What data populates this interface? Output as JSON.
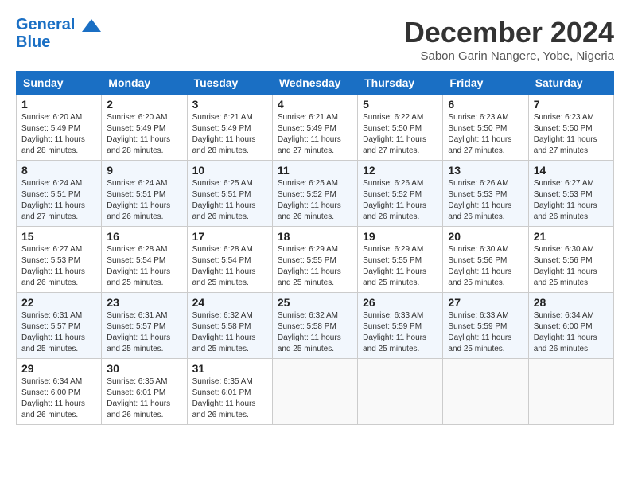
{
  "logo": {
    "line1": "General",
    "line2": "Blue"
  },
  "title": "December 2024",
  "location": "Sabon Garin Nangere, Yobe, Nigeria",
  "headers": [
    "Sunday",
    "Monday",
    "Tuesday",
    "Wednesday",
    "Thursday",
    "Friday",
    "Saturday"
  ],
  "weeks": [
    [
      {
        "day": "1",
        "info": "Sunrise: 6:20 AM\nSunset: 5:49 PM\nDaylight: 11 hours\nand 28 minutes."
      },
      {
        "day": "2",
        "info": "Sunrise: 6:20 AM\nSunset: 5:49 PM\nDaylight: 11 hours\nand 28 minutes."
      },
      {
        "day": "3",
        "info": "Sunrise: 6:21 AM\nSunset: 5:49 PM\nDaylight: 11 hours\nand 28 minutes."
      },
      {
        "day": "4",
        "info": "Sunrise: 6:21 AM\nSunset: 5:49 PM\nDaylight: 11 hours\nand 27 minutes."
      },
      {
        "day": "5",
        "info": "Sunrise: 6:22 AM\nSunset: 5:50 PM\nDaylight: 11 hours\nand 27 minutes."
      },
      {
        "day": "6",
        "info": "Sunrise: 6:23 AM\nSunset: 5:50 PM\nDaylight: 11 hours\nand 27 minutes."
      },
      {
        "day": "7",
        "info": "Sunrise: 6:23 AM\nSunset: 5:50 PM\nDaylight: 11 hours\nand 27 minutes."
      }
    ],
    [
      {
        "day": "8",
        "info": "Sunrise: 6:24 AM\nSunset: 5:51 PM\nDaylight: 11 hours\nand 27 minutes."
      },
      {
        "day": "9",
        "info": "Sunrise: 6:24 AM\nSunset: 5:51 PM\nDaylight: 11 hours\nand 26 minutes."
      },
      {
        "day": "10",
        "info": "Sunrise: 6:25 AM\nSunset: 5:51 PM\nDaylight: 11 hours\nand 26 minutes."
      },
      {
        "day": "11",
        "info": "Sunrise: 6:25 AM\nSunset: 5:52 PM\nDaylight: 11 hours\nand 26 minutes."
      },
      {
        "day": "12",
        "info": "Sunrise: 6:26 AM\nSunset: 5:52 PM\nDaylight: 11 hours\nand 26 minutes."
      },
      {
        "day": "13",
        "info": "Sunrise: 6:26 AM\nSunset: 5:53 PM\nDaylight: 11 hours\nand 26 minutes."
      },
      {
        "day": "14",
        "info": "Sunrise: 6:27 AM\nSunset: 5:53 PM\nDaylight: 11 hours\nand 26 minutes."
      }
    ],
    [
      {
        "day": "15",
        "info": "Sunrise: 6:27 AM\nSunset: 5:53 PM\nDaylight: 11 hours\nand 26 minutes."
      },
      {
        "day": "16",
        "info": "Sunrise: 6:28 AM\nSunset: 5:54 PM\nDaylight: 11 hours\nand 25 minutes."
      },
      {
        "day": "17",
        "info": "Sunrise: 6:28 AM\nSunset: 5:54 PM\nDaylight: 11 hours\nand 25 minutes."
      },
      {
        "day": "18",
        "info": "Sunrise: 6:29 AM\nSunset: 5:55 PM\nDaylight: 11 hours\nand 25 minutes."
      },
      {
        "day": "19",
        "info": "Sunrise: 6:29 AM\nSunset: 5:55 PM\nDaylight: 11 hours\nand 25 minutes."
      },
      {
        "day": "20",
        "info": "Sunrise: 6:30 AM\nSunset: 5:56 PM\nDaylight: 11 hours\nand 25 minutes."
      },
      {
        "day": "21",
        "info": "Sunrise: 6:30 AM\nSunset: 5:56 PM\nDaylight: 11 hours\nand 25 minutes."
      }
    ],
    [
      {
        "day": "22",
        "info": "Sunrise: 6:31 AM\nSunset: 5:57 PM\nDaylight: 11 hours\nand 25 minutes."
      },
      {
        "day": "23",
        "info": "Sunrise: 6:31 AM\nSunset: 5:57 PM\nDaylight: 11 hours\nand 25 minutes."
      },
      {
        "day": "24",
        "info": "Sunrise: 6:32 AM\nSunset: 5:58 PM\nDaylight: 11 hours\nand 25 minutes."
      },
      {
        "day": "25",
        "info": "Sunrise: 6:32 AM\nSunset: 5:58 PM\nDaylight: 11 hours\nand 25 minutes."
      },
      {
        "day": "26",
        "info": "Sunrise: 6:33 AM\nSunset: 5:59 PM\nDaylight: 11 hours\nand 25 minutes."
      },
      {
        "day": "27",
        "info": "Sunrise: 6:33 AM\nSunset: 5:59 PM\nDaylight: 11 hours\nand 25 minutes."
      },
      {
        "day": "28",
        "info": "Sunrise: 6:34 AM\nSunset: 6:00 PM\nDaylight: 11 hours\nand 26 minutes."
      }
    ],
    [
      {
        "day": "29",
        "info": "Sunrise: 6:34 AM\nSunset: 6:00 PM\nDaylight: 11 hours\nand 26 minutes."
      },
      {
        "day": "30",
        "info": "Sunrise: 6:35 AM\nSunset: 6:01 PM\nDaylight: 11 hours\nand 26 minutes."
      },
      {
        "day": "31",
        "info": "Sunrise: 6:35 AM\nSunset: 6:01 PM\nDaylight: 11 hours\nand 26 minutes."
      },
      {
        "day": "",
        "info": ""
      },
      {
        "day": "",
        "info": ""
      },
      {
        "day": "",
        "info": ""
      },
      {
        "day": "",
        "info": ""
      }
    ]
  ]
}
